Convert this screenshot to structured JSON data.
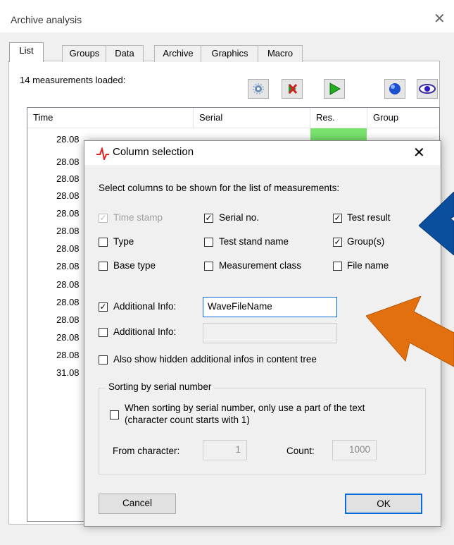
{
  "outer": {
    "title": "Archive analysis",
    "close": "✕",
    "tabs": [
      "List",
      "Groups",
      "Data",
      "Archive",
      "Graphics",
      "Macro"
    ],
    "loaded_label": "14 measurements loaded:",
    "columns": [
      "Time",
      "Serial",
      "Res.",
      "Group"
    ],
    "rows": [
      "28.08",
      "28.08",
      "28.08",
      "28.08",
      "28.08",
      "28.08",
      "28.08",
      "28.08",
      "28.08",
      "28.08",
      "28.08",
      "28.08",
      "28.08",
      "31.08"
    ],
    "result_color": "#79e36d"
  },
  "dialog": {
    "title": "Column selection",
    "close": "✕",
    "instruction": "Select columns to be shown for the list of measurements:",
    "options": {
      "time_stamp": {
        "label": "Time stamp",
        "checked": true,
        "disabled": true
      },
      "serial_no": {
        "label": "Serial no.",
        "checked": true
      },
      "test_result": {
        "label": "Test result",
        "checked": true
      },
      "type": {
        "label": "Type",
        "checked": false
      },
      "test_stand_name": {
        "label": "Test stand name",
        "checked": false
      },
      "groups": {
        "label": "Group(s)",
        "checked": true
      },
      "base_type": {
        "label": "Base type",
        "checked": false
      },
      "measurement_class": {
        "label": "Measurement class",
        "checked": false
      },
      "file_name": {
        "label": "File name",
        "checked": false
      }
    },
    "additional_info_1": {
      "label": "Additional Info:",
      "checked": true,
      "value": "WaveFileName"
    },
    "additional_info_2": {
      "label": "Additional Info:",
      "checked": false,
      "value": ""
    },
    "hidden_infos": {
      "label": "Also show hidden additional infos in content tree",
      "checked": false
    },
    "sorting": {
      "group_title": "Sorting by serial number",
      "partial_label_line1": "When sorting by serial number, only use a part of the text",
      "partial_label_line2": "(character count starts with 1)",
      "partial_checked": false,
      "from_label": "From character:",
      "from_value": "1",
      "count_label": "Count:",
      "count_value": "1000"
    },
    "cancel_label": "Cancel",
    "ok_label": "OK"
  },
  "annotations": {
    "blue_arrow_color": "#0a4f9e",
    "orange_arrow_color": "#e2700f"
  }
}
